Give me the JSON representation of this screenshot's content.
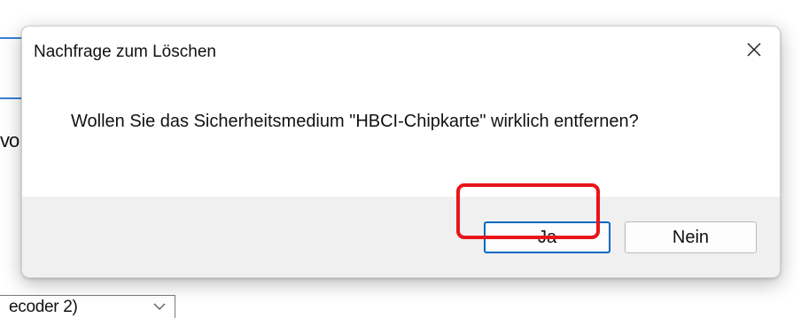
{
  "background": {
    "partial_text": "vo",
    "select_value": "ecoder 2)",
    "chevron_icon": "chevron-down-icon"
  },
  "dialog": {
    "title": "Nachfrage zum Löschen",
    "close_icon": "close-icon",
    "message": "Wollen Sie das Sicherheitsmedium \"HBCI-Chipkarte\" wirklich entfernen?",
    "buttons": {
      "yes": "Ja",
      "no": "Nein"
    }
  },
  "colors": {
    "highlight": "#e8141b",
    "focus_border": "#0067c0",
    "accent_blue": "#3b7fd6"
  }
}
